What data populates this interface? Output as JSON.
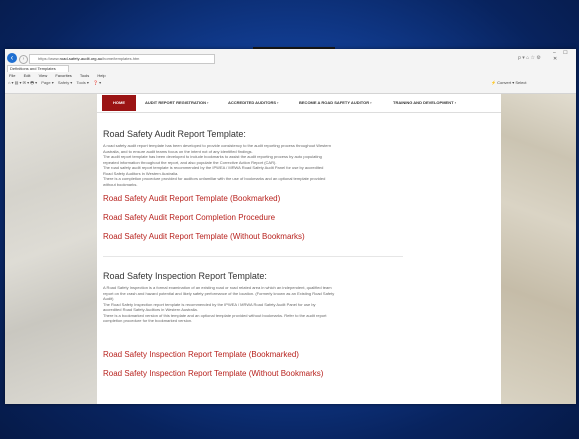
{
  "browser": {
    "url_prefix": "https://www.",
    "url_domain": "road-safety-audit.org.au",
    "url_path": "/home/templates.htm",
    "tab_title": "Definitions and Templates",
    "window_controls": "– ☐ ✕",
    "address_icons": "ρ ▾ ⌂ ☆ ⚙",
    "menu": [
      "File",
      "Edit",
      "View",
      "Favorites",
      "Tools",
      "Help"
    ],
    "commands": [
      "Page ▾",
      "Safety ▾",
      "Tools ▾",
      "❓ ▾"
    ],
    "right_toolbar": "⚡ Convert ▾ Select"
  },
  "nav": {
    "home": "HOME",
    "items": [
      "AUDIT REPORT REGISTRATION",
      "ACCREDITED AUDITORS",
      "BECOME A ROAD SAFETY AUDITOR",
      "TRAINING AND DEVELOPMENT"
    ],
    "arrow": "›"
  },
  "audit": {
    "heading": "Road Safety Audit Report Template:",
    "lines": [
      "A road safety audit report template has been developed to provide consistency to the audit reporting process throughout Western",
      "Australia, and to ensure audit teams focus on the intent not of any identified findings.",
      "The audit report template has been developed to include bookmarks to assist the audit reporting process by auto populating",
      "repeated information throughout the report, and also populate the Corrective Action Report (CAR).",
      "The road safety audit report template is recommended by the IPWEA / MRWA Road Safety Audit Panel for use by accredited",
      "Road Safety Auditors in Western Australia.",
      "There is a completion procedure provided for auditors unfamiliar with the use of bookmarks and an optional template provided",
      "without bookmarks."
    ],
    "links": [
      "Road Safety Audit Report Template (Bookmarked)",
      "Road Safety Audit Report Completion Procedure",
      "Road Safety Audit Report Template (Without Bookmarks)"
    ]
  },
  "inspection": {
    "heading": "Road Safety Inspection Report Template:",
    "lines": [
      "A Road Safety Inspection is a formal examination of an existing road or road related area in which an independent, qualified team",
      "report on the crash and hazard potential and likely safety performance of the location. (Formerly known as an Existing Road Safety",
      "Audit)",
      "The Road Safety Inspection report template is recommended by the IPWEA / MRWA Road Safety Audit Panel for use by",
      "accredited Road Safety Auditors in Western Australia.",
      "There is a bookmarked version of this template and an optional template provided without bookmarks. Refer to the audit report",
      "completion procedure for the bookmarked version."
    ],
    "links": [
      "Road Safety Inspection Report Template (Bookmarked)",
      "Road Safety Inspection Report Template (Without Bookmarks)"
    ]
  }
}
